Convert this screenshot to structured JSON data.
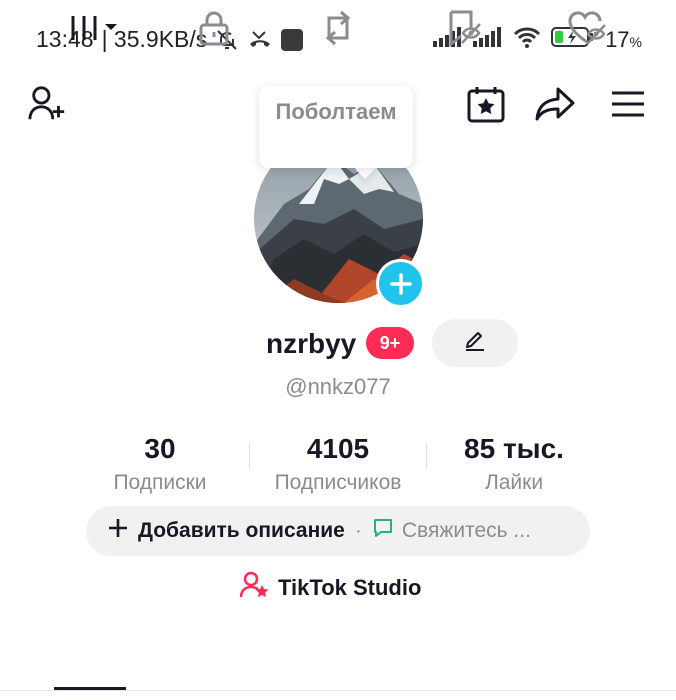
{
  "status_bar": {
    "time": "13:48",
    "speed": "| 35.9KB/s",
    "battery": "17",
    "battery_unit": "%"
  },
  "tooltip": {
    "text": "Поболтаем"
  },
  "profile": {
    "username": "nzrbyy",
    "badge": "9+",
    "handle": "@nnkz077"
  },
  "stats": [
    {
      "value": "30",
      "label": "Подписки"
    },
    {
      "value": "4105",
      "label": "Подписчиков"
    },
    {
      "value": "85 тыс.",
      "label": "Лайки"
    }
  ],
  "bio": {
    "add_label": "Добавить описание",
    "separator": "·",
    "contact_label": "Свяжитесь ..."
  },
  "studio": {
    "label": "TikTok Studio"
  },
  "tabs": [
    {
      "icon": "videos-grid-icon",
      "active": true
    },
    {
      "icon": "lock-icon",
      "active": false
    },
    {
      "icon": "repost-icon",
      "active": false
    },
    {
      "icon": "favorites-bookmark-icon",
      "active": false
    },
    {
      "icon": "liked-heart-icon",
      "active": false
    }
  ],
  "colors": {
    "accent_pink": "#fe2c55",
    "avatar_add": "#20c4ec",
    "contact_green": "#22b573",
    "text_muted": "#8a8b91"
  }
}
